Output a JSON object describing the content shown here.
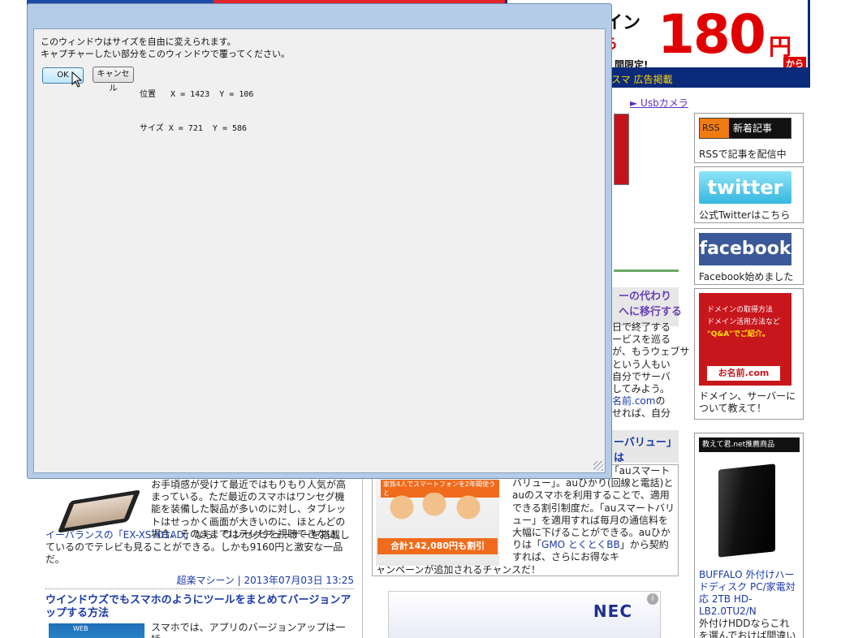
{
  "dialog": {
    "instruction_line1": "このウィンドウはサイズを自由に変えられます。",
    "instruction_line2": "キャプチャーしたい部分をこのウィンドウで覆ってください。",
    "ok_label": "OK",
    "cancel_label": "キャンセル",
    "position_line": "位置   X = 1423  Y = 106",
    "size_line": "サイズ X = 721  Y = 586"
  },
  "banner": {
    "inin": "イン",
    "kara": "ら",
    "price": "180",
    "yen": "円",
    "kara_small": "から",
    "limited": "間限定!",
    "strip": "スマ 広告掲載"
  },
  "links": {
    "usb": "► Usbカメラ"
  },
  "sidebar": {
    "rss_badge": "RSS",
    "rss_new": "新着記事",
    "rss_caption": "RSSで記事を配信中",
    "twitter_logo": "twitter",
    "twitter_caption": "公式Twitterはこちら",
    "facebook_logo": "facebook",
    "facebook_caption": "Facebook始めました",
    "domain_ad_line1": "ドメインの取得方法",
    "domain_ad_line2": "ドメイン活用方法など",
    "domain_ad_line3": "\"Q&A\"でご紹介。",
    "domain_ad_brand": "お名前.com",
    "domain_caption": "ドメイン、サーバーについて教えて！",
    "product_header": "教えて君.net推薦商品",
    "product_link": "BUFFALO 外付けハードディスク PC/家電対応 2TB HD-LB2.0TU2/N",
    "product_desc": "外付けHDDならこれを選んでおけば間違いな"
  },
  "article_right": {
    "title": "ーの代わり\nへに移行する",
    "body_html_free": "日で終了する\nービスを巡る\nが、もうウェブサ\nという人もい\n自分でサーバ\nしてみよう。",
    "link": "名前.com",
    "body_tail": "の\nせれば、自分"
  },
  "smartvalue": {
    "title": "ーバリュー」は"
  },
  "au_article": {
    "image_caption": "家族4人でスマートフォンを2年間使うと",
    "image_label": "合計142,080円も割引",
    "body1": "なることで話題なのが「auスマートバリュー」。auひかり(回線と電話)とauのスマホを利用することで、適用できる割引制度だ。「auスマートバリュー」を適用すれば毎月の通信料を大幅に下げることができる。auひかりは「",
    "body_link": "GMO とくとくBB",
    "body2": "」から契約すれば、さらにお得なキ",
    "bottom": "ャンペーンが追加されるチャンスだ！"
  },
  "nec_ad": {
    "logo": "NEC",
    "info": "i"
  },
  "left_article": {
    "text1": "お手頃感が受けて最近ではもりもり人気が高まっている。ただ最近のスマホはワンセグ機能を装備した製品が多いのに対し、タブレットはせっかく画面が大きいのに、ほとんどの場合、そのままではテレビを視聴できない。",
    "link1": "イーバランスの「EX-XS701AD」",
    "text2": "なら、ワンセグチューナーを搭載しているのでテレビも見ることができる。しかも9160円と激安な一品だ。",
    "meta_author": "超楽マシーン",
    "meta_date": "2013年07月03日 13:25",
    "headline2": "ウインドウズでもスマホのようにツールをまとめてバージョンアップする方法",
    "thumb_label": "WEB",
    "text3": "スマホでは、アプリのバージョンアップは一括"
  }
}
